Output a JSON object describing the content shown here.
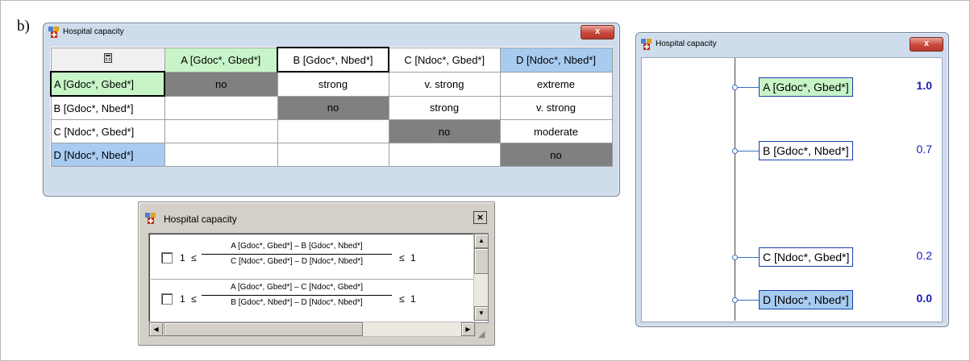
{
  "figure_label": "b)",
  "window_matrix": {
    "title": "Hospital capacity",
    "close_label": "x",
    "corner_icon": "calculator-icon",
    "columns": [
      "A [Gdoc*, Gbed*]",
      "B [Gdoc*, Nbed*]",
      "C [Ndoc*, Gbed*]",
      "D [Ndoc*, Nbed*]"
    ],
    "rows": [
      {
        "label": "A [Gdoc*, Gbed*]",
        "cells": [
          "no",
          "strong",
          "v. strong",
          "extreme"
        ]
      },
      {
        "label": "B [Gdoc*, Nbed*]",
        "cells": [
          "",
          "no",
          "strong",
          "v. strong"
        ]
      },
      {
        "label": "C [Ndoc*, Gbed*]",
        "cells": [
          "",
          "",
          "no",
          "moderate"
        ]
      },
      {
        "label": "D [Ndoc*, Nbed*]",
        "cells": [
          "",
          "",
          "",
          "no"
        ]
      }
    ],
    "colors": {
      "green": "#c8f5c8",
      "blue": "#a8cbf0",
      "diagonal": "#808080"
    }
  },
  "window_constraints": {
    "title": "Hospital capacity",
    "close_label": "×",
    "constraints": [
      {
        "lower": "1",
        "le": "≤",
        "numerator": "A [Gdoc*, Gbed*]  –  B [Gdoc*, Nbed*]",
        "denominator": "C [Ndoc*, Gbed*]  –  D [Ndoc*, Nbed*]",
        "upper": "1"
      },
      {
        "lower": "1",
        "le": "≤",
        "numerator": "A [Gdoc*, Gbed*]  –  C [Ndoc*, Gbed*]",
        "denominator": "B [Gdoc*, Nbed*]  –  D [Ndoc*, Nbed*]",
        "upper": "1"
      }
    ]
  },
  "window_scale": {
    "title": "Hospital capacity",
    "close_label": "x",
    "items": [
      {
        "label": "A [Gdoc*, Gbed*]",
        "value": "1.0",
        "score": 1.0,
        "bold": true,
        "fill": "#c8f5c8"
      },
      {
        "label": "B [Gdoc*, Nbed*]",
        "value": "0.7",
        "score": 0.7,
        "bold": false,
        "fill": "#ffffff"
      },
      {
        "label": "C [Ndoc*, Gbed*]",
        "value": "0.2",
        "score": 0.2,
        "bold": false,
        "fill": "#ffffff"
      },
      {
        "label": "D [Ndoc*, Nbed*]",
        "value": "0.0",
        "score": 0.0,
        "bold": true,
        "fill": "#a8cbf0"
      }
    ]
  }
}
